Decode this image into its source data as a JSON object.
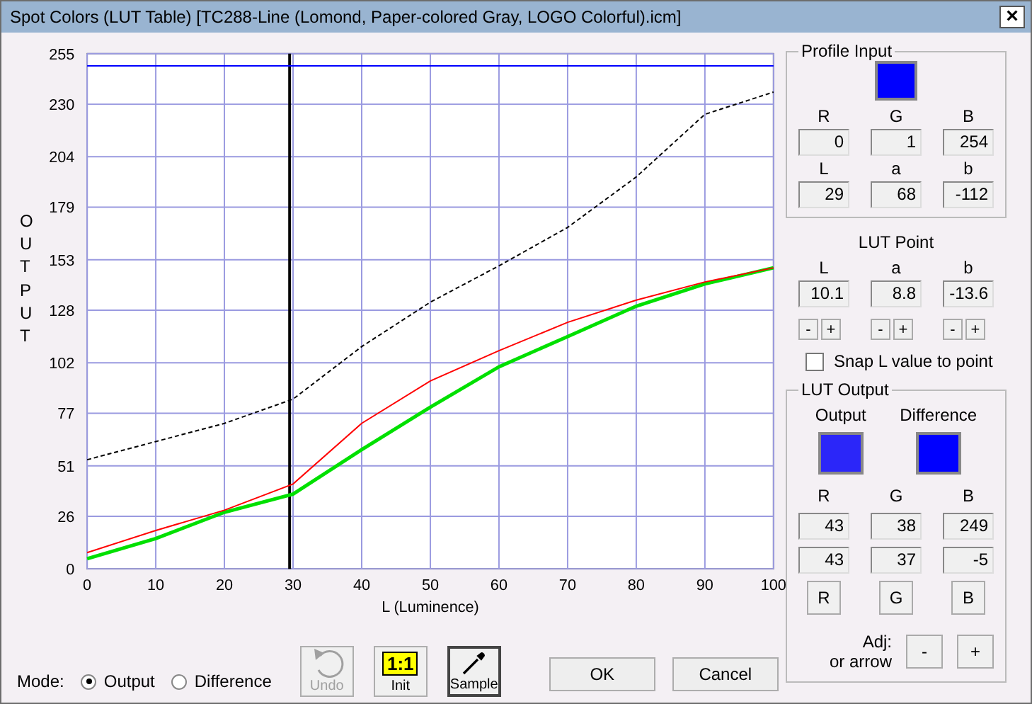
{
  "window": {
    "title": "Spot Colors (LUT Table) [TC288-Line (Lomond, Paper-colored Gray, LOGO Colorful).icm]",
    "close": "×"
  },
  "chart": {
    "ylabel_letters": "OUTPUT",
    "chart_data": {
      "type": "line",
      "xlabel": "L (Luminence)",
      "x": [
        0,
        10,
        20,
        30,
        40,
        50,
        60,
        70,
        80,
        90,
        100
      ],
      "xlim": [
        0,
        100
      ],
      "ylim": [
        0,
        255
      ],
      "xticks": [
        0,
        10,
        20,
        30,
        40,
        50,
        60,
        70,
        80,
        90,
        100
      ],
      "yticks": [
        0,
        26,
        51,
        77,
        102,
        128,
        153,
        179,
        204,
        230,
        255
      ],
      "series": [
        {
          "color": "#0000ff",
          "line_style": "solid",
          "values": [
            249,
            249,
            249,
            249,
            249,
            249,
            249,
            249,
            249,
            249,
            249
          ]
        },
        {
          "color": "#000000",
          "line_style": "dashed",
          "values": [
            54,
            63,
            72,
            84,
            110,
            132,
            150,
            169,
            194,
            225,
            236
          ]
        },
        {
          "color": "#ff0000",
          "line_style": "solid",
          "values": [
            8,
            19,
            29,
            42,
            72,
            93,
            108,
            122,
            133,
            142,
            149
          ]
        },
        {
          "color": "#00e000",
          "line_style": "solid",
          "values": [
            5,
            15,
            28,
            37,
            59,
            80,
            100,
            115,
            130,
            141,
            149
          ]
        }
      ],
      "grid": true,
      "ref_lines": [
        {
          "axis": "x",
          "value": 29.5,
          "color": "#000000"
        }
      ]
    }
  },
  "mode": {
    "label": "Mode:",
    "options": [
      {
        "label": "Output",
        "selected": true
      },
      {
        "label": "Difference",
        "selected": false
      }
    ]
  },
  "tools": [
    {
      "kind": "undo",
      "label": "Undo",
      "disabled": true
    },
    {
      "kind": "init",
      "label": "Init",
      "badge": "1:1",
      "disabled": false
    },
    {
      "kind": "sample",
      "label": "Sample",
      "disabled": false
    }
  ],
  "buttons": [
    "OK",
    "Cancel"
  ],
  "profile_input": {
    "title": "Profile Input",
    "color": "#0000fe",
    "rgb_labels": [
      "R",
      "G",
      "B"
    ],
    "rgb": [
      "0",
      "1",
      "254"
    ],
    "lab_labels": [
      "L",
      "a",
      "b"
    ],
    "lab": [
      "29",
      "68",
      "-112"
    ]
  },
  "lut_point": {
    "title": "LUT Point",
    "labels": [
      "L",
      "a",
      "b"
    ],
    "values": [
      "10.1",
      "8.8",
      "-13.6"
    ],
    "steppers": [
      [
        "-",
        "+"
      ],
      [
        "-",
        "+"
      ],
      [
        "-",
        "+"
      ]
    ]
  },
  "snap": {
    "label": "Snap L value to point",
    "checked": false
  },
  "lut_output": {
    "title": "LUT Output",
    "swatches": [
      {
        "label": "Output",
        "color": "#2b26f9"
      },
      {
        "label": "Difference",
        "color": "#0000ff"
      }
    ],
    "labels": [
      "R",
      "G",
      "B"
    ],
    "output": [
      "43",
      "38",
      "249"
    ],
    "difference": [
      "43",
      "37",
      "-5"
    ],
    "channel_buttons": [
      "R",
      "G",
      "B"
    ],
    "adj_label": "Adj:",
    "adj_sub": "or arrow",
    "adj_buttons": [
      "-",
      "+"
    ]
  }
}
